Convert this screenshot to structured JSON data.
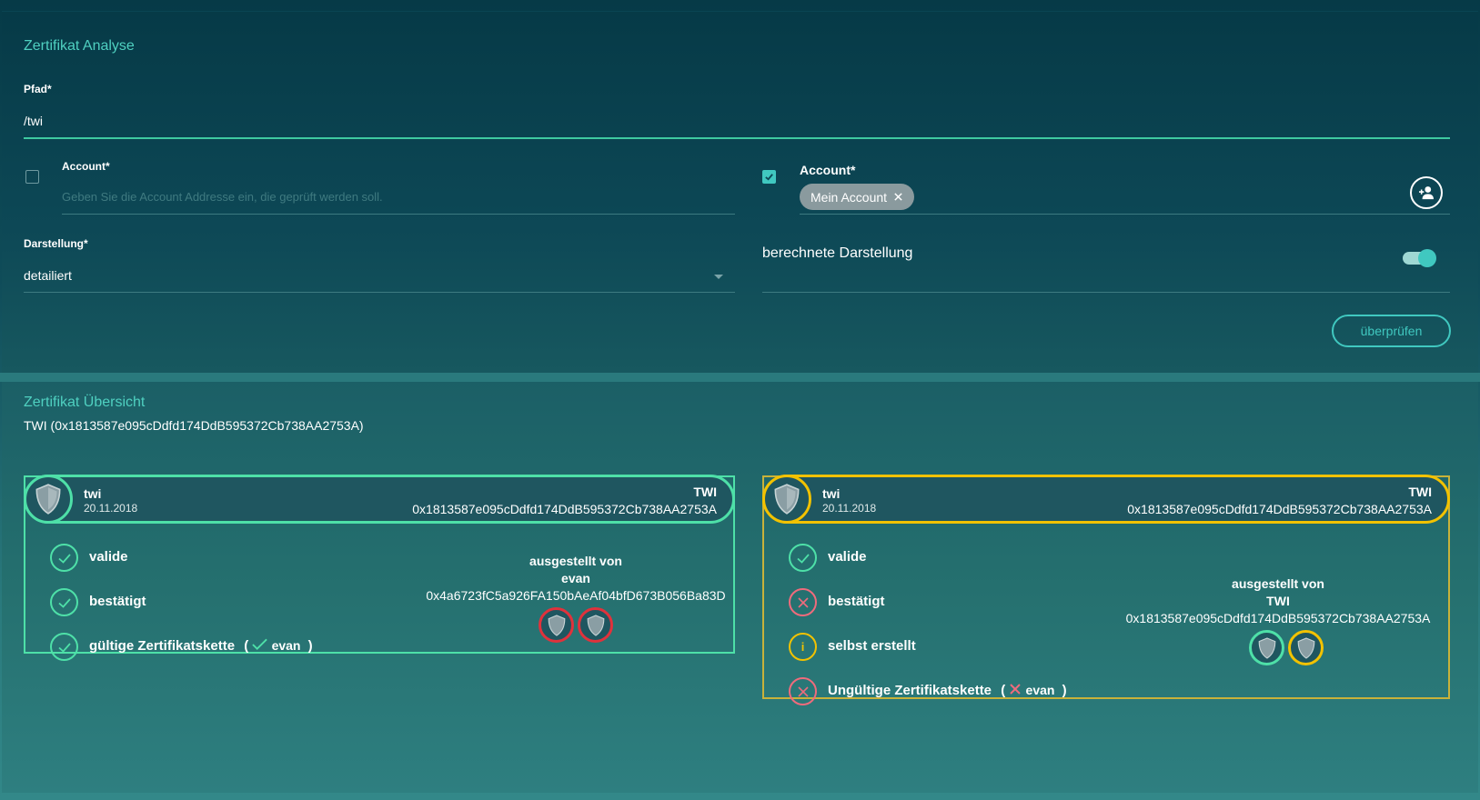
{
  "analysis": {
    "title": "Zertifikat Analyse",
    "path_label": "Pfad*",
    "path_value": "/twi",
    "account_left": {
      "label": "Account*",
      "placeholder": "Geben Sie die Account Addresse ein, die geprüft werden soll.",
      "checked": false
    },
    "account_right": {
      "label": "Account*",
      "chip_label": "Mein Account",
      "checked": true
    },
    "display_label": "Darstellung*",
    "display_value": "detailiert",
    "computed_label": "berechnete Darstellung",
    "computed_on": true,
    "check_button": "überprüfen"
  },
  "overview": {
    "title": "Zertifikat Übersicht",
    "subtitle": "TWI (0x1813587e095cDdfd174DdB595372Cb738AA2753A)",
    "cards": [
      {
        "accent": "#4ee0a8",
        "name": "twi",
        "date": "20.11.2018",
        "issuer": "TWI",
        "address": "0x1813587e095cDdfd174DdB595372Cb738AA2753A",
        "statuses": [
          {
            "kind": "check",
            "label": "valide"
          },
          {
            "kind": "check",
            "label": "bestätigt"
          },
          {
            "kind": "check",
            "label": "gültige Zertifikatskette",
            "chain_open": "(",
            "chain_name": "evan",
            "chain_close": ")"
          }
        ],
        "issued_by": {
          "title": "ausgestellt von",
          "name": "evan",
          "address": "0x4a6723fC5a926FA150bAeAf04bfD673B056Ba83D"
        }
      },
      {
        "accent": "#f2c200",
        "name": "twi",
        "date": "20.11.2018",
        "issuer": "TWI",
        "address": "0x1813587e095cDdfd174DdB595372Cb738AA2753A",
        "statuses": [
          {
            "kind": "check",
            "label": "valide"
          },
          {
            "kind": "cross",
            "label": "bestätigt"
          },
          {
            "kind": "info",
            "label": "selbst erstellt"
          },
          {
            "kind": "cross",
            "label": "Ungültige Zertifikatskette",
            "chain_open": "(",
            "chain_name": "evan",
            "chain_close": ")"
          }
        ],
        "issued_by": {
          "title": "ausgestellt von",
          "name": "TWI",
          "address": "0x1813587e095cDdfd174DdB595372Cb738AA2753A"
        }
      }
    ]
  },
  "icons": {
    "shield": "shield-icon",
    "check": "check-circle-icon",
    "cross": "cross-circle-icon",
    "info": "info-circle-icon",
    "add_user": "add-user-icon",
    "close": "close-icon",
    "dropdown": "chevron-down-icon"
  }
}
